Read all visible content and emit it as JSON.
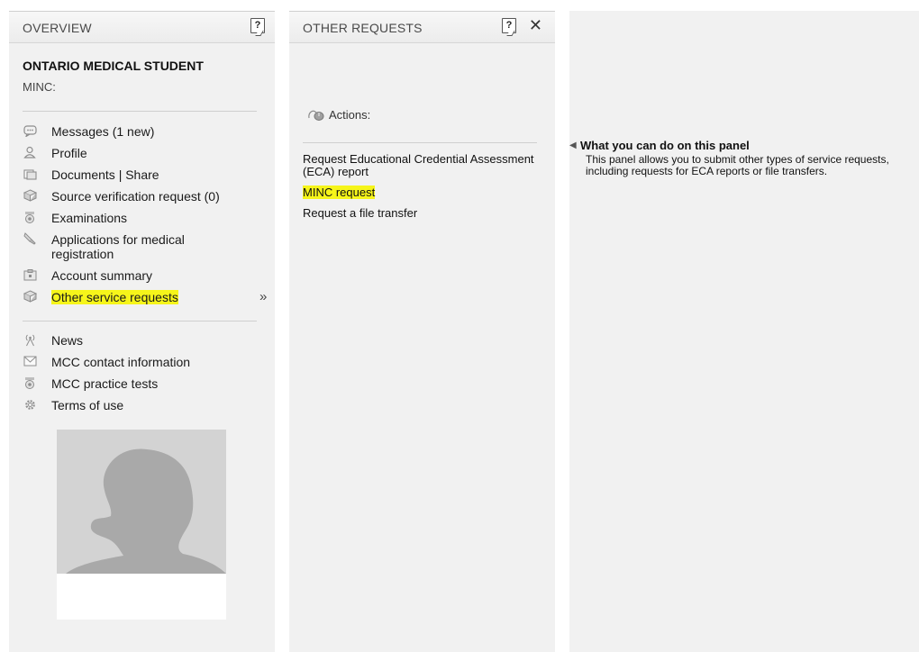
{
  "overview": {
    "title": "OVERVIEW",
    "help_label": "?",
    "user_name": "ONTARIO MEDICAL STUDENT",
    "minc_label": "MINC:",
    "menu_primary": [
      {
        "label": "Messages (1 new)",
        "icon": "message-icon"
      },
      {
        "label": "Profile",
        "icon": "profile-icon"
      },
      {
        "label": "Documents | Share",
        "icon": "documents-icon"
      },
      {
        "label": "Source verification request (0)",
        "icon": "verification-icon"
      },
      {
        "label": "Examinations",
        "icon": "examinations-icon"
      },
      {
        "label": "Applications for medical registration",
        "icon": "applications-icon"
      },
      {
        "label": "Account summary",
        "icon": "account-icon"
      },
      {
        "label": "Other service requests",
        "icon": "service-requests-icon",
        "highlighted": true,
        "chevron": "»"
      }
    ],
    "menu_secondary": [
      {
        "label": "News",
        "icon": "news-icon"
      },
      {
        "label": "MCC contact information",
        "icon": "mail-icon"
      },
      {
        "label": "MCC practice tests",
        "icon": "practice-tests-icon"
      },
      {
        "label": "Terms of use",
        "icon": "gear-icon"
      }
    ]
  },
  "other_requests": {
    "title": "OTHER REQUESTS",
    "help_label": "?",
    "close_label": "✕",
    "actions_label": "Actions:",
    "requests": [
      {
        "label": "Request Educational Credential Assessment (ECA) report"
      },
      {
        "label": "MINC request",
        "highlighted": true
      },
      {
        "label": "Request a file transfer"
      }
    ]
  },
  "help_panel": {
    "title": "What you can do on this panel",
    "text": "This panel allows you to submit other types of service requests, including requests for ECA reports or file transfers."
  },
  "colors": {
    "highlight": "#f6f51a",
    "panel_bg": "#f1f1f1",
    "photo_bg": "#d3d3d3",
    "silhouette": "#a9a9a9"
  }
}
